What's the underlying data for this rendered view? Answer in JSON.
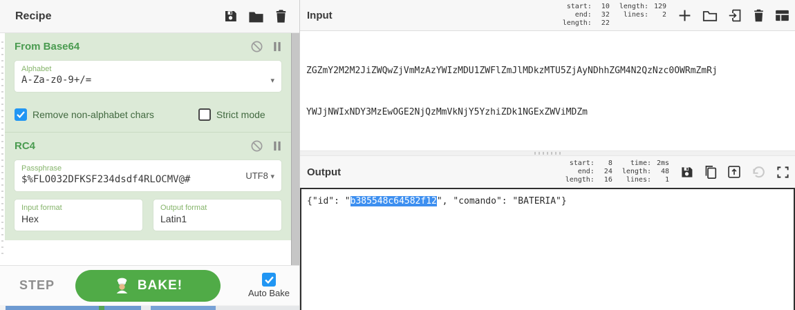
{
  "recipe": {
    "title": "Recipe",
    "header_icons": [
      "save-icon",
      "folder-icon",
      "trash-icon"
    ],
    "operations": [
      {
        "name": "From Base64",
        "icons": [
          "disable-icon",
          "breakpoint-pause-icon"
        ],
        "args": [
          {
            "label": "Alphabet",
            "value": "A-Za-z0-9+/=",
            "icon": "chevron-down-icon"
          }
        ],
        "checkboxes": [
          {
            "label": "Remove non-alphabet chars",
            "checked": true
          },
          {
            "label": "Strict mode",
            "checked": false
          }
        ]
      },
      {
        "name": "RC4",
        "icons": [
          "disable-icon",
          "breakpoint-pause-icon"
        ],
        "args": [
          {
            "label": "Passphrase",
            "value": "$%FLO032DFKSF234dsdf4RLOCMV@#",
            "type_selector": "UTF8",
            "icon": "chevron-down-icon"
          },
          {
            "label": "Input format",
            "value": "Hex"
          },
          {
            "label": "Output format",
            "value": "Latin1"
          }
        ]
      }
    ],
    "controls": {
      "step": "STEP",
      "bake": "BAKE!",
      "bake_icon": "chef-hat-icon",
      "auto_bake": {
        "label": "Auto Bake",
        "checked": true
      }
    }
  },
  "input": {
    "title": "Input",
    "stats": {
      "col1": [
        {
          "label": "start:",
          "value": "10"
        },
        {
          "label": "end:",
          "value": "32"
        },
        {
          "label": "length:",
          "value": "22"
        }
      ],
      "col2": [
        {
          "label": "length:",
          "value": "129"
        },
        {
          "label": "lines:",
          "value": "2"
        }
      ]
    },
    "icons": [
      "add-tab-icon",
      "open-folder-icon",
      "open-file-icon",
      "trash-icon",
      "input-settings-icon"
    ],
    "lines": [
      "ZGZmY2M2M2JiZWQwZjVmMzAzYWIzMDU1ZWFlZmJlMDkzMTU5ZjAyNDhhZGM4N2QzNzc0OWRmZmRj",
      "YWJjNWIxNDY3MzEwOGE2NjQzMmVkNjY5YzhiZDk1NGExZWViMDZm"
    ]
  },
  "output": {
    "title": "Output",
    "stats": {
      "col1": [
        {
          "label": "start:",
          "value": "8"
        },
        {
          "label": "end:",
          "value": "24"
        },
        {
          "label": "length:",
          "value": "16"
        }
      ],
      "col2": [
        {
          "label": "time:",
          "value": "2ms"
        },
        {
          "label": "length:",
          "value": "48"
        },
        {
          "label": "lines:",
          "value": "1"
        }
      ]
    },
    "icons": [
      "save-icon",
      "copy-icon",
      "replace-input-icon",
      "undo-icon",
      "maximise-icon"
    ],
    "text_before": "{\"id\": \"",
    "selected": "b385548c64582f12",
    "text_after": "\", \"comando\": \"BATERIA\"}"
  },
  "colors": {
    "operation_card_bg": "#dcead7",
    "operation_title_green": "#4a9b50",
    "arg_label_green": "#85b46a",
    "checkbox_blue": "#2196f3",
    "bake_button_green": "#50ab47",
    "selection_blue": "#3d8ff0"
  }
}
